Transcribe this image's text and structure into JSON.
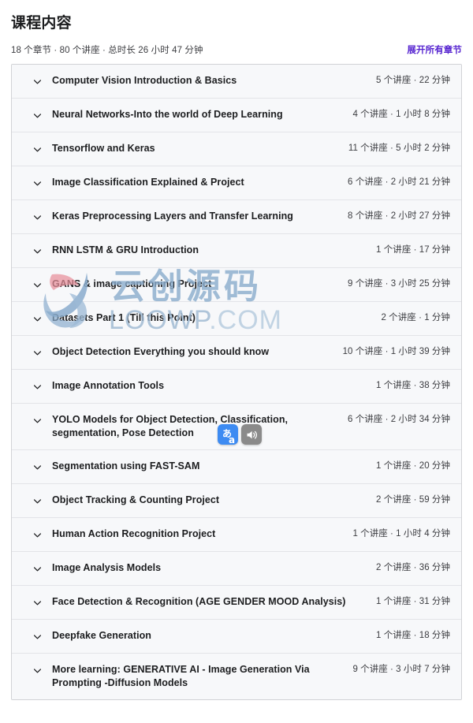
{
  "header": {
    "title": "课程内容",
    "summary": "18 个章节 · 80 个讲座 · 总时长 26 小时 47 分钟",
    "expand_all_label": "展开所有章节",
    "accent_color": "#5624d0"
  },
  "float_tools": {
    "translate": {
      "icon": "translate-icon",
      "ja_glyph": "あ",
      "latin_glyph": "a"
    },
    "speak": {
      "icon": "speaker-icon"
    }
  },
  "watermark": {
    "logo": "leaf-swirl-logo",
    "chinese": "云创源码",
    "domain_main": "LOOWP",
    "domain_tld": ".COM",
    "color": "#8aaccd"
  },
  "sections": [
    {
      "title": "Computer Vision Introduction & Basics",
      "stats": "5 个讲座 · 22 分钟"
    },
    {
      "title": "Neural Networks-Into the world of Deep Learning",
      "stats": "4 个讲座 · 1 小时 8 分钟"
    },
    {
      "title": "Tensorflow and Keras",
      "stats": "11 个讲座 · 5 小时 2 分钟"
    },
    {
      "title": "Image Classification Explained & Project",
      "stats": "6 个讲座 · 2 小时 21 分钟"
    },
    {
      "title": "Keras Preprocessing Layers and Transfer Learning",
      "stats": "8 个讲座 · 2 小时 27 分钟"
    },
    {
      "title": "RNN LSTM & GRU Introduction",
      "stats": "1 个讲座 · 17 分钟"
    },
    {
      "title": "GANS & image captioning Project",
      "stats": "9 个讲座 · 3 小时 25 分钟"
    },
    {
      "title": "Datasets Part 1 (Till this Point)",
      "stats": "2 个讲座 · 1 分钟"
    },
    {
      "title": "Object Detection Everything you should know",
      "stats": "10 个讲座 · 1 小时 39 分钟"
    },
    {
      "title": "Image Annotation Tools",
      "stats": "1 个讲座 · 38 分钟"
    },
    {
      "title": "YOLO Models for Object Detection, Classification, segmentation, Pose Detection",
      "stats": "6 个讲座 · 2 小时 34 分钟"
    },
    {
      "title": "Segmentation using FAST-SAM",
      "stats": "1 个讲座 · 20 分钟"
    },
    {
      "title": "Object Tracking & Counting Project",
      "stats": "2 个讲座 · 59 分钟"
    },
    {
      "title": "Human Action Recognition Project",
      "stats": "1 个讲座 · 1 小时 4 分钟"
    },
    {
      "title": "Image Analysis Models",
      "stats": "2 个讲座 · 36 分钟"
    },
    {
      "title": "Face Detection & Recognition (AGE GENDER MOOD Analysis)",
      "stats": "1 个讲座 · 31 分钟"
    },
    {
      "title": "Deepfake Generation",
      "stats": "1 个讲座 · 18 分钟"
    },
    {
      "title": "More learning: GENERATIVE AI - Image Generation Via Prompting -Diffusion Models",
      "stats": "9 个讲座 · 3 小时 7 分钟"
    }
  ]
}
